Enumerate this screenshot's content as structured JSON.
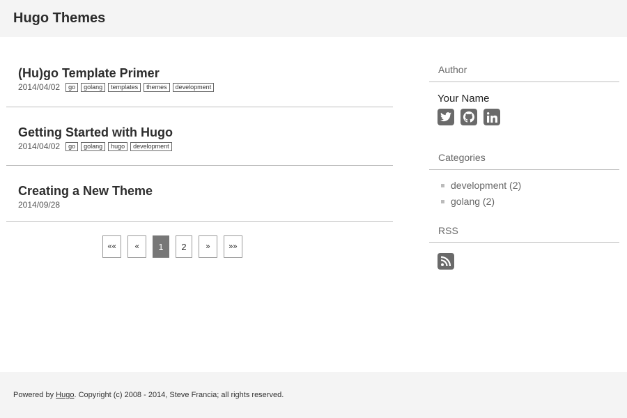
{
  "site": {
    "title": "Hugo Themes"
  },
  "posts": [
    {
      "title": "(Hu)go Template Primer",
      "date": "2014/04/02",
      "tags": [
        "go",
        "golang",
        "templates",
        "themes",
        "development"
      ]
    },
    {
      "title": "Getting Started with Hugo",
      "date": "2014/04/02",
      "tags": [
        "go",
        "golang",
        "hugo",
        "development"
      ]
    },
    {
      "title": "Creating a New Theme",
      "date": "2014/09/28",
      "tags": []
    }
  ],
  "pagination": {
    "first": "««",
    "prev": "«",
    "pages": [
      "1",
      "2"
    ],
    "current": "1",
    "next": "»",
    "last": "»»"
  },
  "sidebar": {
    "author_heading": "Author",
    "author_name": "Your Name",
    "social_icons": [
      "twitter-icon",
      "github-icon",
      "linkedin-icon"
    ],
    "categories_heading": "Categories",
    "categories": [
      "development (2)",
      "golang (2)"
    ],
    "rss_heading": "RSS",
    "rss_icon": "rss-icon"
  },
  "footer": {
    "prefix": "Powered by ",
    "link": "Hugo",
    "suffix": ". Copyright (c) 2008 - 2014, Steve Francia; all rights reserved."
  },
  "colors": {
    "header_bg": "#f4f4f4",
    "icon_bg": "#6a6a6a",
    "active_page": "#777777",
    "divider": "#bdbdbd"
  }
}
